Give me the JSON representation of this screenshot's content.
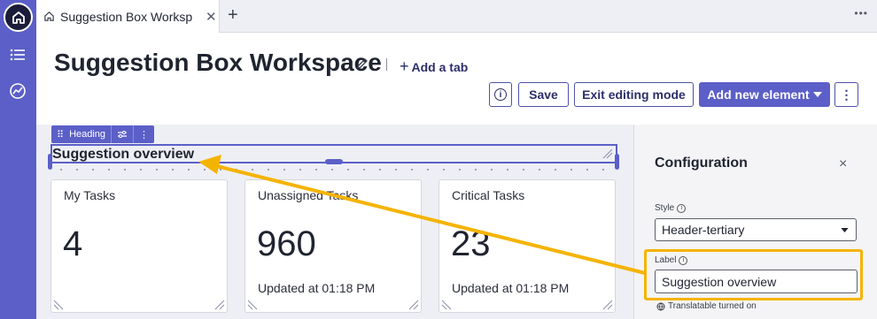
{
  "tabbar": {
    "tab_title": "Suggestion Box Worksp...",
    "close_glyph": "✕",
    "add_glyph": "+",
    "more_glyph": "•••"
  },
  "header": {
    "title": "Suggestion Box Workspace",
    "add_tab_label": "Add a tab"
  },
  "toolbar": {
    "info_glyph": "i",
    "save_label": "Save",
    "exit_label": "Exit editing mode",
    "add_element_label": "Add new element",
    "more_glyph": "⋮"
  },
  "heading_widget": {
    "tag_label": "Heading",
    "text": "Suggestion overview"
  },
  "cards": [
    {
      "title": "My Tasks",
      "value": "4",
      "footer": ""
    },
    {
      "title": "Unassigned Tasks",
      "value": "960",
      "footer": "Updated at 01:18 PM"
    },
    {
      "title": "Critical Tasks",
      "value": "23",
      "footer": "Updated at 01:18 PM"
    }
  ],
  "config": {
    "title": "Configuration",
    "close_glyph": "×",
    "style_label": "Style",
    "style_value": "Header-tertiary",
    "label_label": "Label",
    "label_value": "Suggestion overview",
    "translatable_text": "Translatable turned on"
  },
  "colors": {
    "accent": "#5b5fc7",
    "highlight": "#f5b301",
    "rail_home": "#1b1b3a"
  },
  "icons": [
    "home-icon",
    "list-icon",
    "analytics-icon",
    "pencil-icon",
    "info-icon",
    "kebab-icon",
    "globe-icon",
    "drag-icon",
    "settings-icon"
  ]
}
